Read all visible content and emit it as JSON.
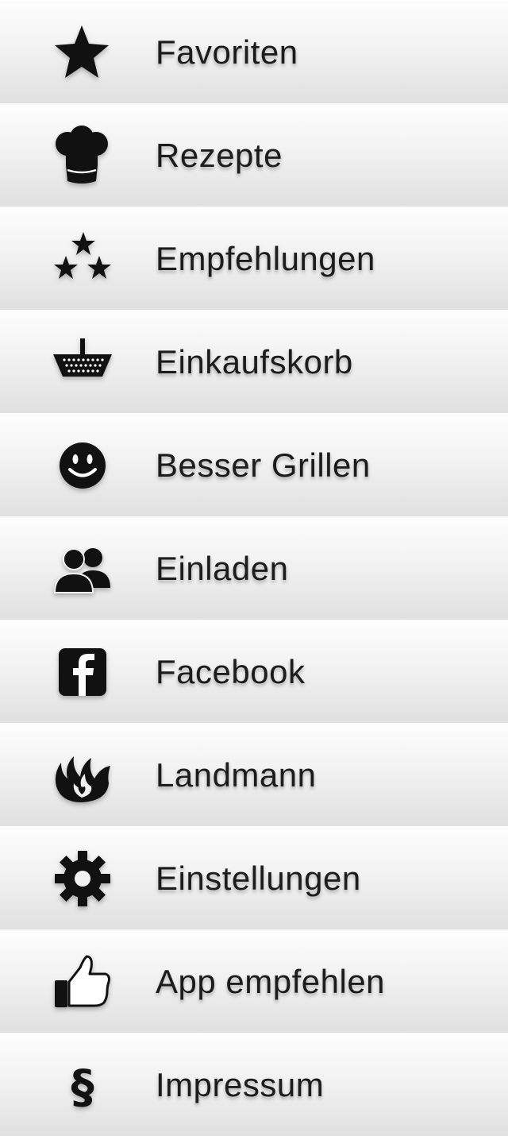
{
  "menu": {
    "items": [
      {
        "label": "Favoriten",
        "icon": "star-icon"
      },
      {
        "label": "Rezepte",
        "icon": "chef-hat-icon"
      },
      {
        "label": "Empfehlungen",
        "icon": "three-stars-icon"
      },
      {
        "label": "Einkaufskorb",
        "icon": "basket-icon"
      },
      {
        "label": "Besser Grillen",
        "icon": "smiley-icon"
      },
      {
        "label": "Einladen",
        "icon": "users-icon"
      },
      {
        "label": "Facebook",
        "icon": "facebook-icon"
      },
      {
        "label": "Landmann",
        "icon": "flame-logo-icon"
      },
      {
        "label": "Einstellungen",
        "icon": "gear-icon"
      },
      {
        "label": "App empfehlen",
        "icon": "thumbs-up-icon"
      },
      {
        "label": "Impressum",
        "icon": "section-sign-icon"
      }
    ]
  },
  "colors": {
    "icon": "#111111",
    "text": "#1c1c1c",
    "row_top": "#fdfdfd",
    "row_bottom": "#e0e0e0"
  }
}
